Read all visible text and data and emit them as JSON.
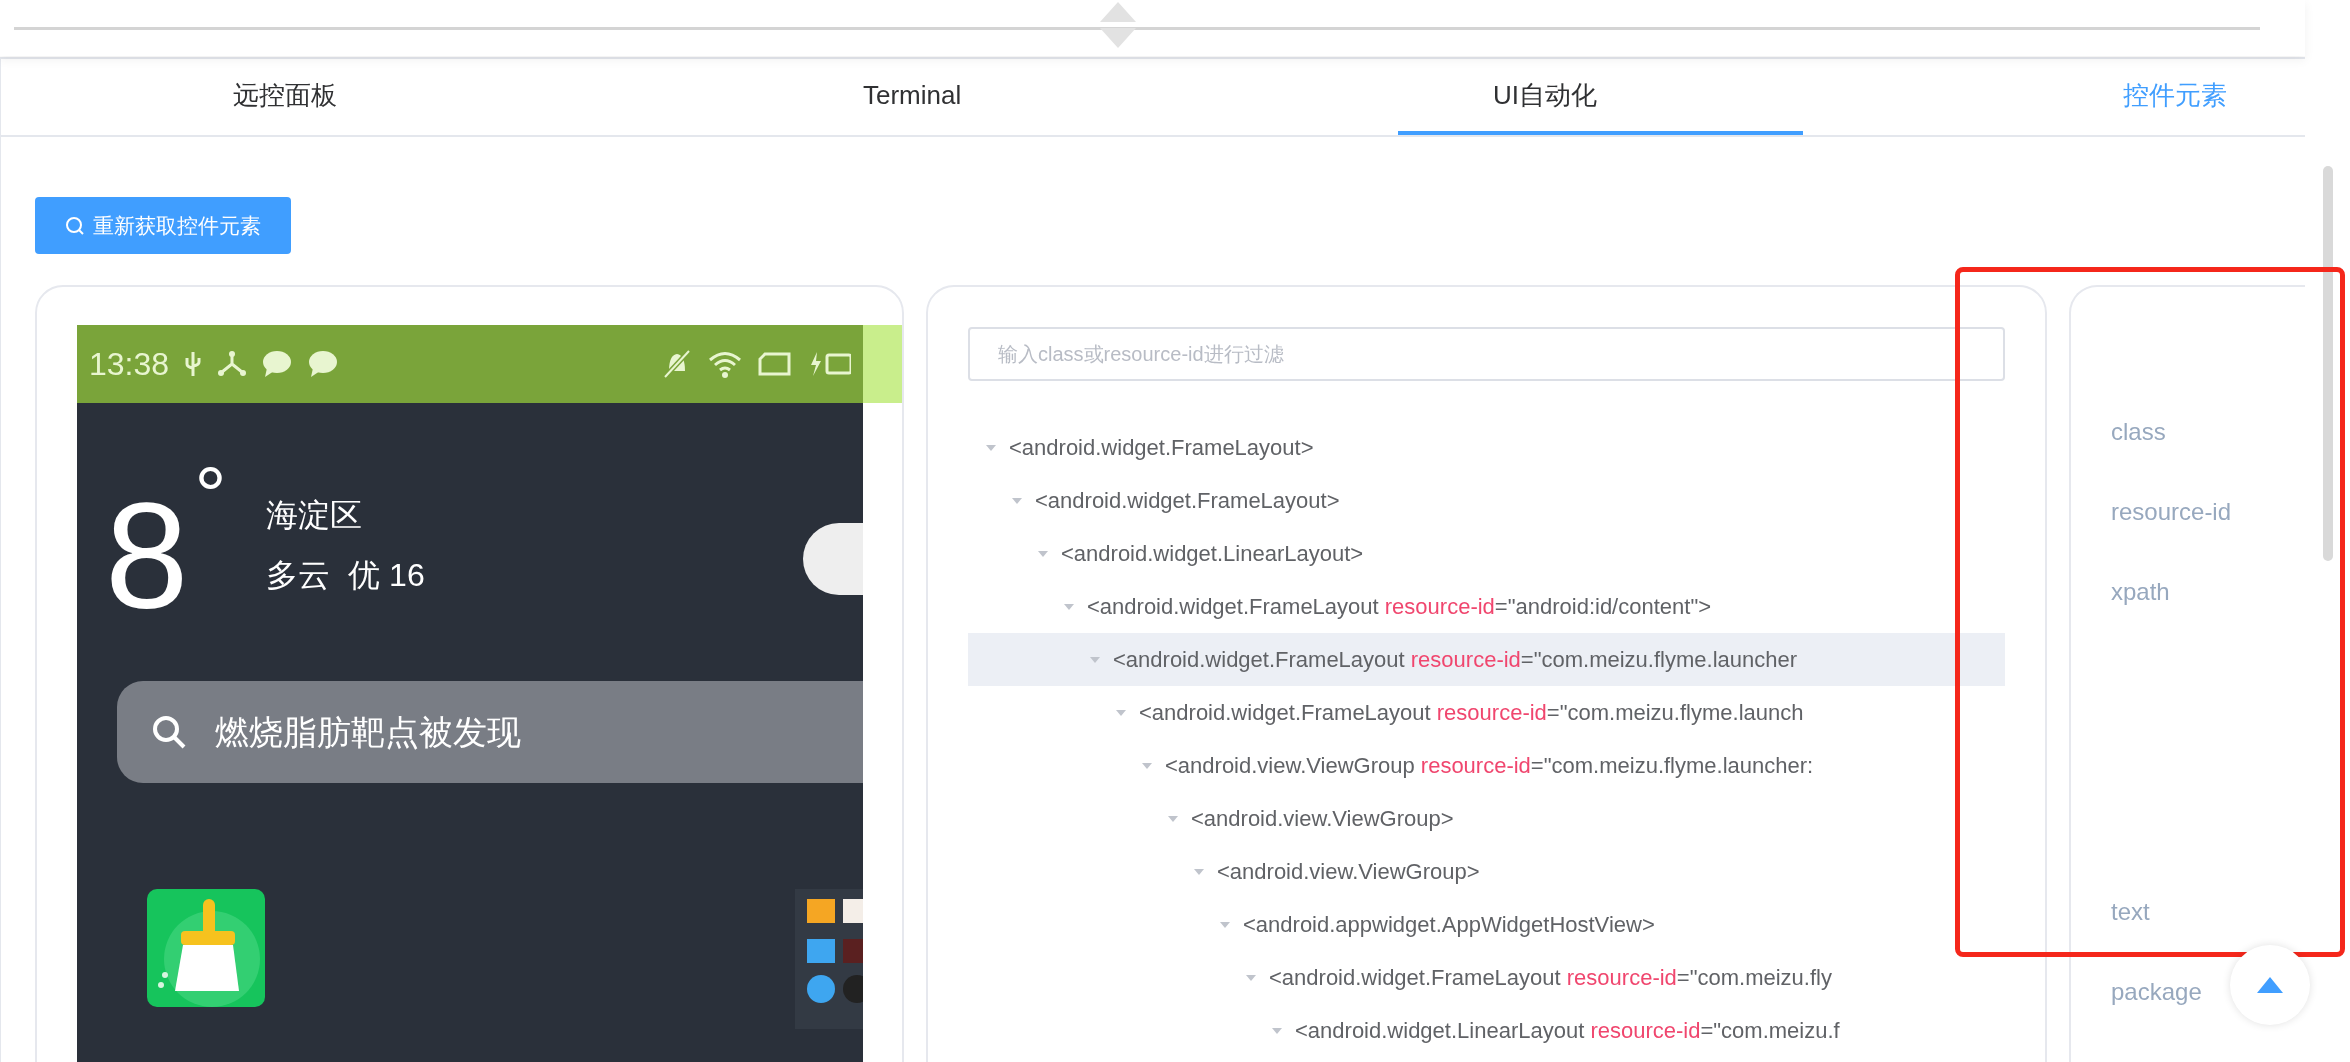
{
  "tabs": [
    {
      "label": "远控面板",
      "selected": false,
      "hovered": false
    },
    {
      "label": "Terminal",
      "selected": false,
      "hovered": false
    },
    {
      "label": "UI自动化",
      "selected": true,
      "hovered": false
    },
    {
      "label": "控件元素",
      "selected": false,
      "hovered": true
    }
  ],
  "refresh_button": "重新获取控件元素",
  "device_screen": {
    "time": "13:38",
    "temperature": "8",
    "degree": "°",
    "district": "海淀区",
    "weather": "多云  优 16",
    "search_text": "燃烧脂肪靶点被发现"
  },
  "filter": {
    "placeholder": "输入class或resource-id进行过滤"
  },
  "tree": [
    {
      "tag": "<android.widget.FrameLayout>",
      "expanded": true,
      "selected": false,
      "children": [
        {
          "tag": "<android.widget.FrameLayout>",
          "expanded": true,
          "selected": false,
          "children": [
            {
              "tag": "<android.widget.LinearLayout>",
              "expanded": true,
              "selected": false,
              "children": [
                {
                  "tag": "<android.widget.FrameLayout",
                  "attr": "resource-id",
                  "value": "=\"android:id/content\">",
                  "expanded": true,
                  "selected": false,
                  "children": [
                    {
                      "tag": "<android.widget.FrameLayout",
                      "attr": "resource-id",
                      "value": "=\"com.meizu.flyme.launcher",
                      "expanded": true,
                      "selected": true,
                      "children": [
                        {
                          "tag": "<android.widget.FrameLayout",
                          "attr": "resource-id",
                          "value": "=\"com.meizu.flyme.launch",
                          "expanded": true,
                          "selected": false,
                          "children": [
                            {
                              "tag": "<android.view.ViewGroup",
                              "attr": "resource-id",
                              "value": "=\"com.meizu.flyme.launcher:",
                              "expanded": true,
                              "selected": false,
                              "children": [
                                {
                                  "tag": "<android.view.ViewGroup>",
                                  "expanded": true,
                                  "selected": false,
                                  "children": [
                                    {
                                      "tag": "<android.view.ViewGroup>",
                                      "expanded": true,
                                      "selected": false,
                                      "children": [
                                        {
                                          "tag": "<android.appwidget.AppWidgetHostView>",
                                          "expanded": true,
                                          "selected": false,
                                          "children": [
                                            {
                                              "tag": "<android.widget.FrameLayout",
                                              "attr": "resource-id",
                                              "value": "=\"com.meizu.fly",
                                              "expanded": true,
                                              "selected": false,
                                              "children": [
                                                {
                                                  "tag": "<android.widget.LinearLayout",
                                                  "attr": "resource-id",
                                                  "value": "=\"com.meizu.f",
                                                  "expanded": true,
                                                  "selected": false
                                                }
                                              ]
                                            }
                                          ]
                                        }
                                      ]
                                    }
                                  ]
                                }
                              ]
                            }
                          ]
                        }
                      ]
                    }
                  ]
                }
              ]
            }
          ]
        }
      ]
    }
  ],
  "properties": [
    {
      "label": "class",
      "kind": "line"
    },
    {
      "label": "resource-id",
      "kind": "line"
    },
    {
      "label": "xpath",
      "kind": "block"
    },
    {
      "label": "text",
      "kind": "line"
    },
    {
      "label": "package",
      "kind": "line"
    }
  ]
}
